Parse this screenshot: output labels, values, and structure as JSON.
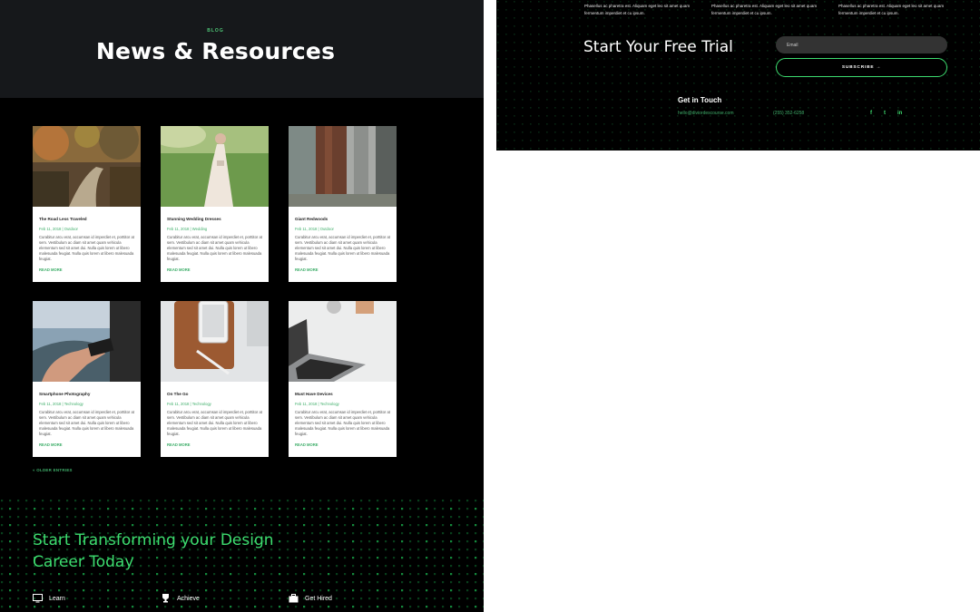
{
  "blog_page": {
    "eyebrow": "BLOG",
    "title": "News & Resources",
    "posts": [
      {
        "title": "The Road Less Traveled",
        "meta": "Feb 11, 2018 | Outdoor",
        "excerpt": "Curabitur arcu erat, accumsan id imperdiet et, porttitor at sem. Vestibulum ac diam sit amet quam vehicula elementum sed sit amet dui. Nulla quis lorem ut libero malesuada feugiat. Nulla quis lorem ut libero malesuada feugiat.",
        "read_more": "READ MORE"
      },
      {
        "title": "Stunning Wedding Dresses",
        "meta": "Feb 11, 2018 | Wedding",
        "excerpt": "Curabitur arcu erat, accumsan id imperdiet et, porttitor at sem. Vestibulum ac diam sit amet quam vehicula elementum sed sit amet dui. Nulla quis lorem ut libero malesuada feugiat. Nulla quis lorem ut libero malesuada feugiat.",
        "read_more": "READ MORE"
      },
      {
        "title": "Giant Redwoods",
        "meta": "Feb 11, 2018 | Outdoor",
        "excerpt": "Curabitur arcu erat, accumsan id imperdiet et, porttitor at sem. Vestibulum ac diam sit amet quam vehicula elementum sed sit amet dui. Nulla quis lorem ut libero malesuada feugiat. Nulla quis lorem ut libero malesuada feugiat.",
        "read_more": "READ MORE"
      },
      {
        "title": "Smartphone Photography",
        "meta": "Feb 11, 2018 | Technology",
        "excerpt": "Curabitur arcu erat, accumsan id imperdiet et, porttitor at sem. Vestibulum ac diam sit amet quam vehicula elementum sed sit amet dui. Nulla quis lorem ut libero malesuada feugiat. Nulla quis lorem ut libero malesuada feugiat.",
        "read_more": "READ MORE"
      },
      {
        "title": "On The Go",
        "meta": "Feb 11, 2018 | Technology",
        "excerpt": "Curabitur arcu erat, accumsan id imperdiet et, porttitor at sem. Vestibulum ac diam sit amet quam vehicula elementum sed sit amet dui. Nulla quis lorem ut libero malesuada feugiat. Nulla quis lorem ut libero malesuada feugiat.",
        "read_more": "READ MORE"
      },
      {
        "title": "Must Have Devices",
        "meta": "Feb 11, 2018 | Technology",
        "excerpt": "Curabitur arcu erat, accumsan id imperdiet et, porttitor at sem. Vestibulum ac diam sit amet quam vehicula elementum sed sit amet dui. Nulla quis lorem ut libero malesuada feugiat. Nulla quis lorem ut libero malesuada feugiat.",
        "read_more": "READ MORE"
      }
    ],
    "older_entries": "« OLDER ENTRIES",
    "cta": {
      "line1": "Start Transforming your Design",
      "line2": "Career Today",
      "features": [
        {
          "label": "Learn",
          "icon": "monitor-icon"
        },
        {
          "label": "Achieve",
          "icon": "trophy-icon"
        },
        {
          "label": "Get Hired",
          "icon": "briefcase-icon"
        }
      ]
    }
  },
  "footer_page": {
    "columns": [
      "Phasellus ac pharetra est. Aliquam eget leo sit amet quam fermentum imperdiet et cu ipsum.",
      "Phasellus ac pharetra est. Aliquam eget leo sit amet quam fermentum imperdiet et cu ipsum.",
      "Phasellus ac pharetra est. Aliquam eget leo sit amet quam fermentum imperdiet et cu ipsum."
    ],
    "trial_title": "Start Your Free Trial",
    "email_placeholder": "Email",
    "subscribe_label": "SUBSCRIBE →",
    "get_in_touch": "Get in Touch",
    "email": "hello@diviordescourse.com",
    "phone": "(255) 352-6258",
    "social": [
      "f",
      "t",
      "in"
    ]
  },
  "colors": {
    "accent": "#3ddc6f",
    "dark": "#16181b",
    "black": "#000000"
  }
}
